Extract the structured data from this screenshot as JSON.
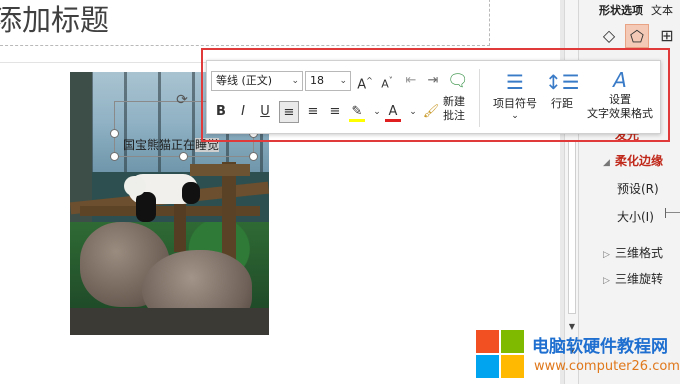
{
  "slide": {
    "title": "添加标题",
    "textbox_text_before": "国宝熊猫正在",
    "textbox_text_highlight": "睡觉"
  },
  "format_pane": {
    "tab_shape_options": "形状选项",
    "tab_text_options": "文本",
    "items": [
      {
        "label": "发光",
        "expanded": false,
        "active": true
      },
      {
        "label": "柔化边缘",
        "expanded": true,
        "active": true
      },
      {
        "label": "预设(R)",
        "expanded": null,
        "active": false
      },
      {
        "label": "大小(I)",
        "expanded": null,
        "active": false
      },
      {
        "label": "三维格式",
        "expanded": false,
        "active": false
      },
      {
        "label": "三维旋转",
        "expanded": false,
        "active": false
      }
    ],
    "icons": [
      "fill-bucket-icon",
      "pentagon-icon",
      "size-icon"
    ]
  },
  "mini_toolbar": {
    "font_name": "等线 (正文)",
    "font_size": "18",
    "increase_font": "A",
    "decrease_font": "A",
    "bold": "B",
    "italic": "I",
    "underline": "U",
    "highlight_letter": "✎",
    "font_color_letter": "A",
    "new_comment": "新建\n批注",
    "new_comment_l1": "新建",
    "new_comment_l2": "批注",
    "bullets": "项目符号",
    "line_spacing": "行距",
    "format_text_effects_l1": "设置",
    "format_text_effects_l2": "文字效果格式"
  },
  "colors": {
    "highlight_color": "#ffff00",
    "font_color": "#e02020",
    "accent_red_box": "#e03a3a",
    "pane_active_text": "#c0281a"
  },
  "watermark": {
    "line1": "电脑软硬件教程网",
    "line2": "www.computer26.com"
  }
}
